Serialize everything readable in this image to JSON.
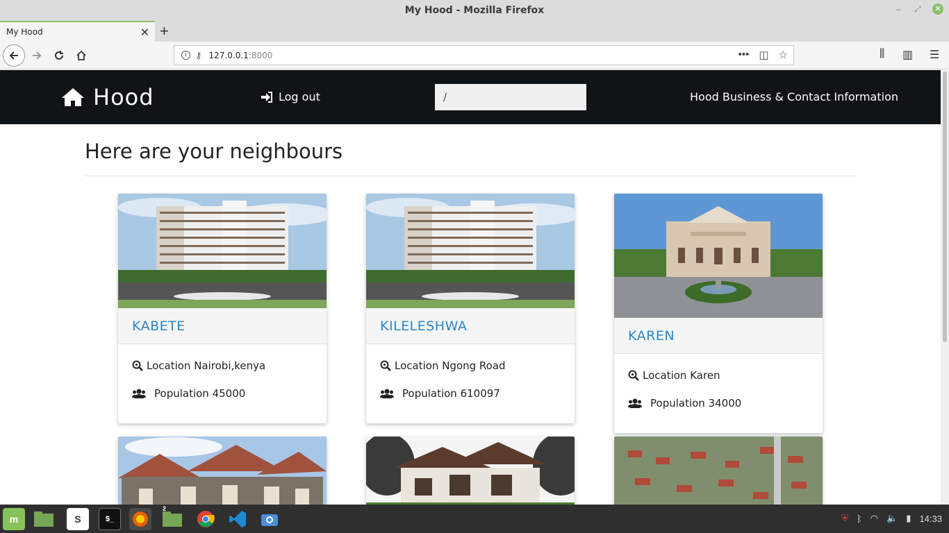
{
  "browser": {
    "window_title": "My Hood - Mozilla Firefox",
    "tab_title": "My Hood",
    "url_host": "127.0.0.1",
    "url_port": ":8000"
  },
  "site": {
    "brand": "Hood",
    "logout": "Log out",
    "search_value": "/",
    "business_link": "Hood Business & Contact Information",
    "heading": "Here are your neighbours"
  },
  "hoods": [
    {
      "name": "KABETE",
      "location": "Location Nairobi,kenya",
      "population": "Population 45000"
    },
    {
      "name": "KILELESHWA",
      "location": "Location Ngong Road",
      "population": "Population 610097"
    },
    {
      "name": "KAREN",
      "location": "Location Karen",
      "population": "Population 34000"
    }
  ],
  "taskbar": {
    "clock": "14:33",
    "workspace_badge": "2"
  },
  "colors": {
    "nav_bg": "#111416",
    "link": "#2a86c9",
    "card_caption_bg": "#f5f5f5"
  }
}
